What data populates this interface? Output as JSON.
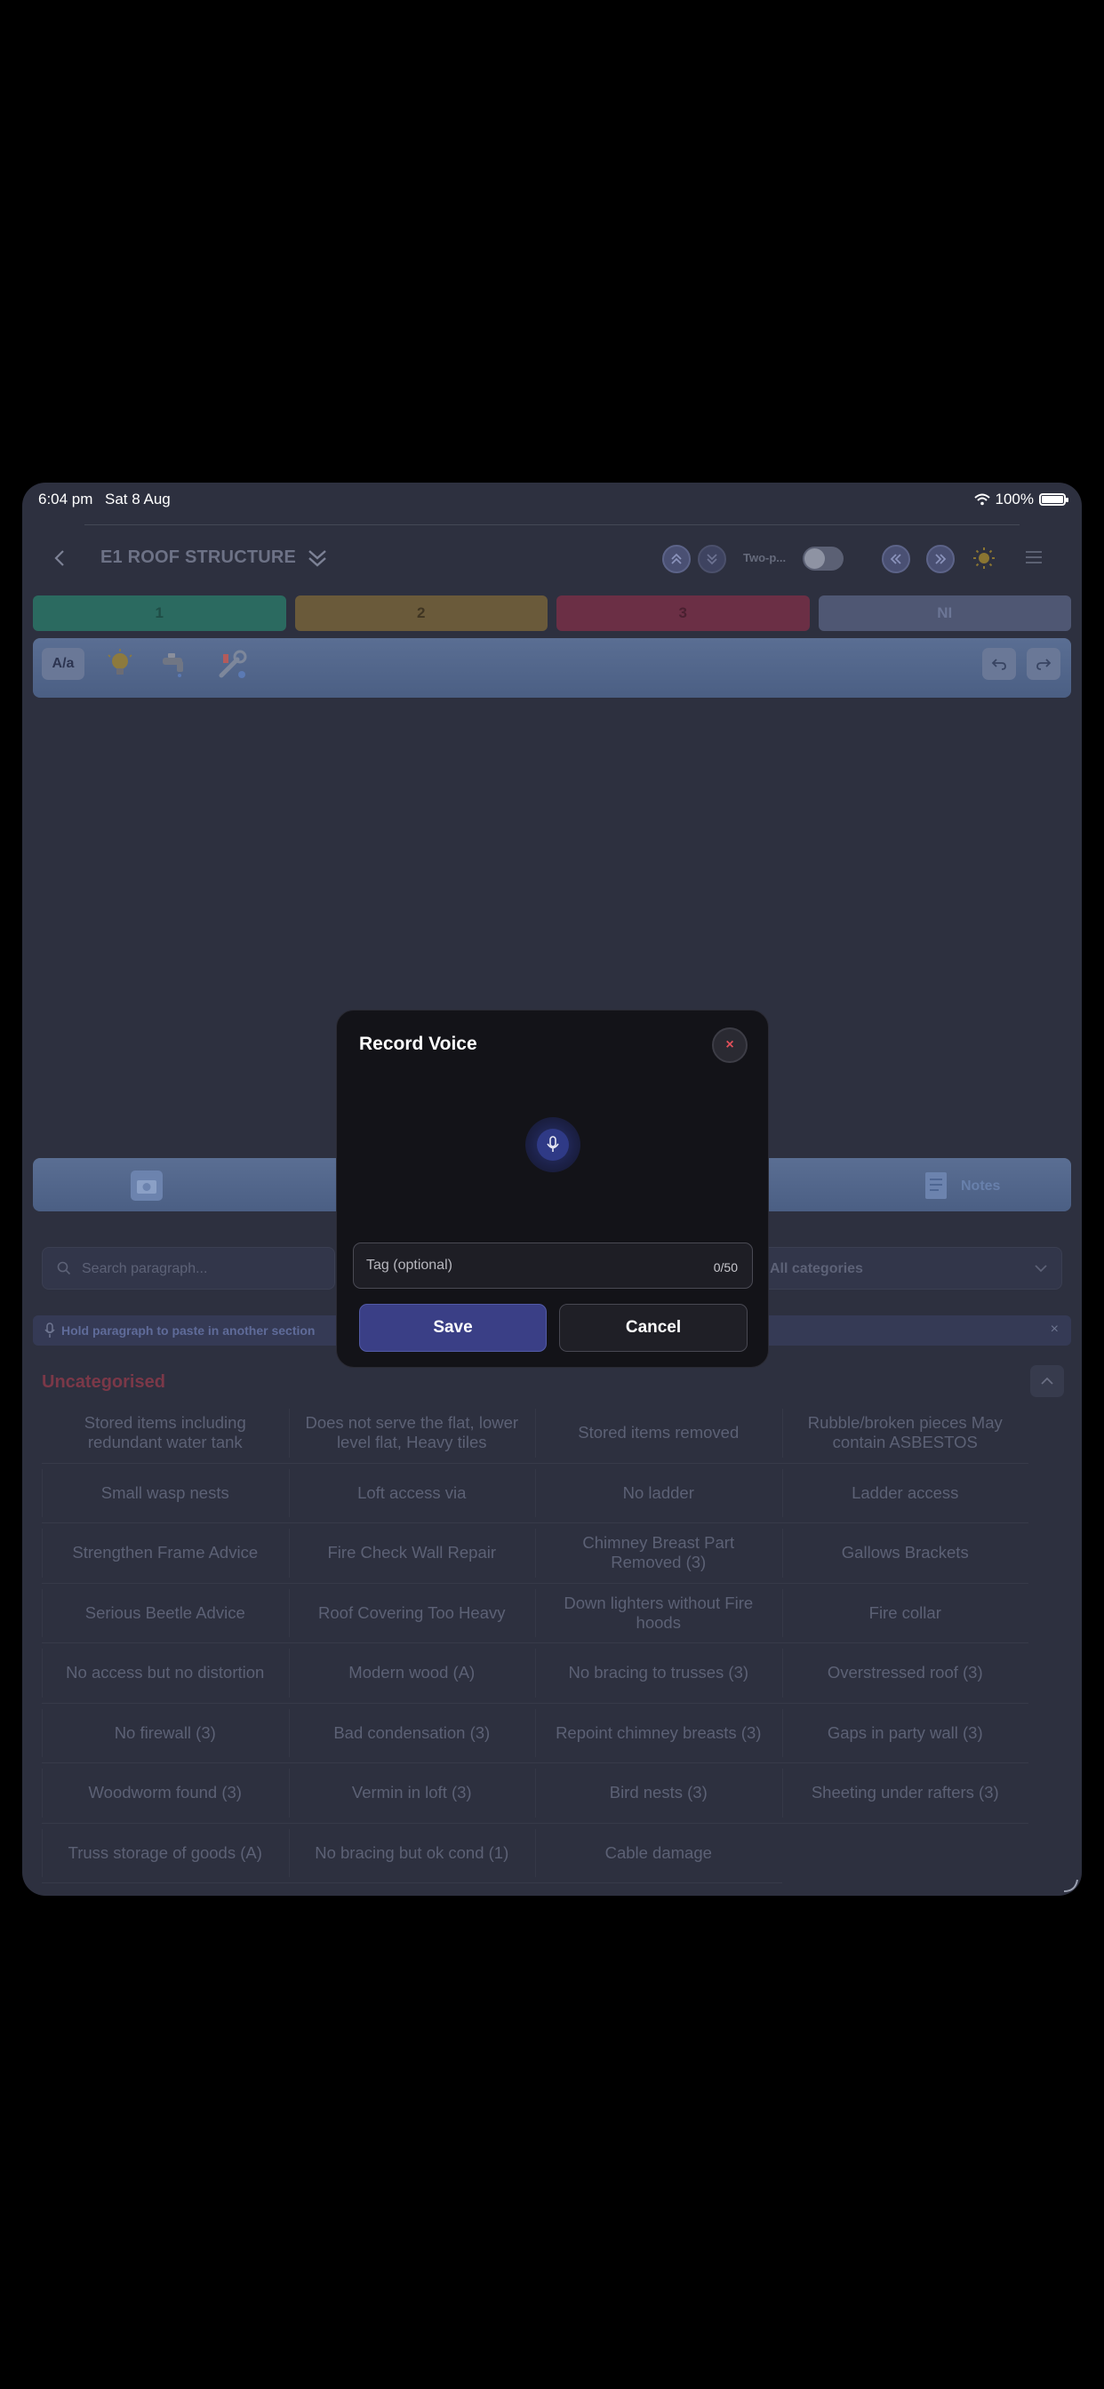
{
  "status_bar": {
    "time": "6:04 pm",
    "date": "Sat 8 Aug",
    "battery": "100%",
    "battery_level": 1.0
  },
  "header": {
    "title": "E1 ROOF STRUCTURE",
    "two_page_label": "Two-p...",
    "two_page_enabled": false
  },
  "tabs": [
    {
      "label": "1",
      "color": "#2b6a60",
      "text_color": "#1f4d46"
    },
    {
      "label": "2",
      "color": "#6a5a3a",
      "text_color": "#3f3522"
    },
    {
      "label": "3",
      "color": "#6b2f45",
      "text_color": "#4a2030"
    },
    {
      "label": "NI",
      "color": "#4f5773",
      "text_color": "#6c7696"
    }
  ],
  "toolbar": {
    "font_button": "A/a"
  },
  "bottom_bar": {
    "notes_label": "Notes"
  },
  "search": {
    "placeholder": "Search paragraph..."
  },
  "category_select": {
    "value": "All categories"
  },
  "hint": {
    "text": "Hold paragraph to paste in another section"
  },
  "category": {
    "title": "Uncategorised"
  },
  "paragraphs": [
    "Stored items including redundant water tank",
    "Does not serve the flat, lower level flat, Heavy tiles",
    "Stored items removed",
    "Rubble/broken pieces May contain ASBESTOS",
    "Small wasp nests",
    "Loft access via",
    "No ladder",
    "Ladder access",
    "Strengthen Frame Advice",
    "Fire Check Wall Repair",
    "Chimney Breast Part Removed (3)",
    "Gallows Brackets",
    "Serious Beetle Advice",
    "Roof Covering Too Heavy",
    "Down lighters without Fire hoods",
    "Fire collar",
    "No access but no distortion",
    "Modern wood (A)",
    "No bracing to trusses (3)",
    "Overstressed roof (3)",
    "No firewall (3)",
    "Bad condensation (3)",
    "Repoint chimney breasts (3)",
    "Gaps in party wall (3)",
    "Woodworm found (3)",
    "Vermin in loft (3)",
    "Bird nests (3)",
    "Sheeting under rafters (3)",
    "Truss storage of goods (A)",
    "No bracing but ok cond (1)",
    "Cable damage"
  ],
  "modal": {
    "title": "Record Voice",
    "close_label": "×",
    "tag_placeholder": "Tag (optional)",
    "tag_counter": "0/50",
    "save_label": "Save",
    "cancel_label": "Cancel"
  }
}
